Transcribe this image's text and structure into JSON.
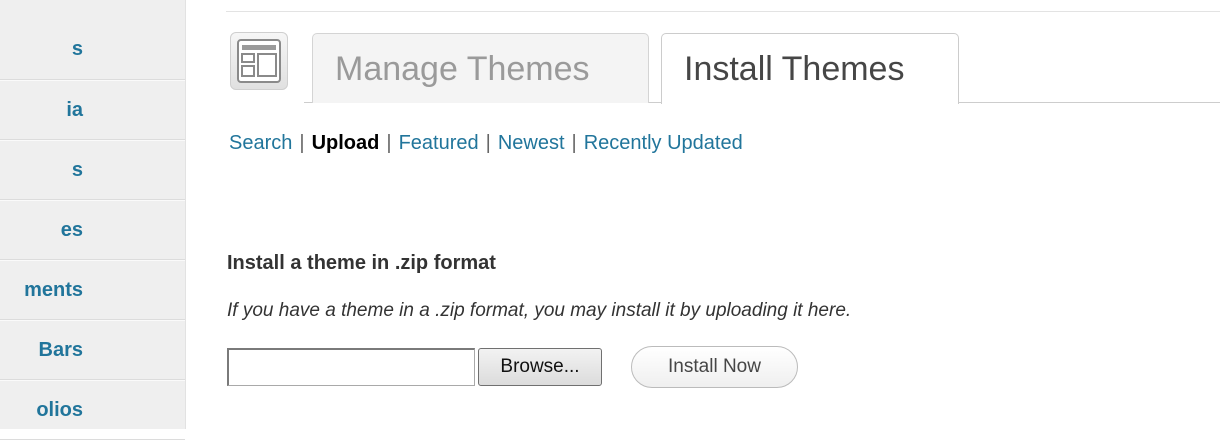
{
  "sidebar": {
    "items": [
      {
        "label": "s"
      },
      {
        "label": "ia"
      },
      {
        "label": "s"
      },
      {
        "label": "es"
      },
      {
        "label": "ments"
      },
      {
        "label": "Bars"
      },
      {
        "label": "olios"
      }
    ]
  },
  "header": {
    "icon": "themes-layout-icon",
    "tabs": [
      {
        "label": "Manage Themes",
        "active": false
      },
      {
        "label": "Install Themes",
        "active": true
      }
    ]
  },
  "subnav": {
    "items": [
      {
        "label": "Search",
        "current": false
      },
      {
        "label": "Upload",
        "current": true
      },
      {
        "label": "Featured",
        "current": false
      },
      {
        "label": "Newest",
        "current": false
      },
      {
        "label": "Recently Updated",
        "current": false
      }
    ],
    "separator": "|"
  },
  "upload": {
    "heading": "Install a theme in .zip format",
    "description": "If you have a theme in a .zip format, you may install it by uploading it here.",
    "file_value": "",
    "browse_label": "Browse...",
    "install_label": "Install Now"
  },
  "colors": {
    "link": "#21759b",
    "sidebar_bg": "#efefef"
  }
}
